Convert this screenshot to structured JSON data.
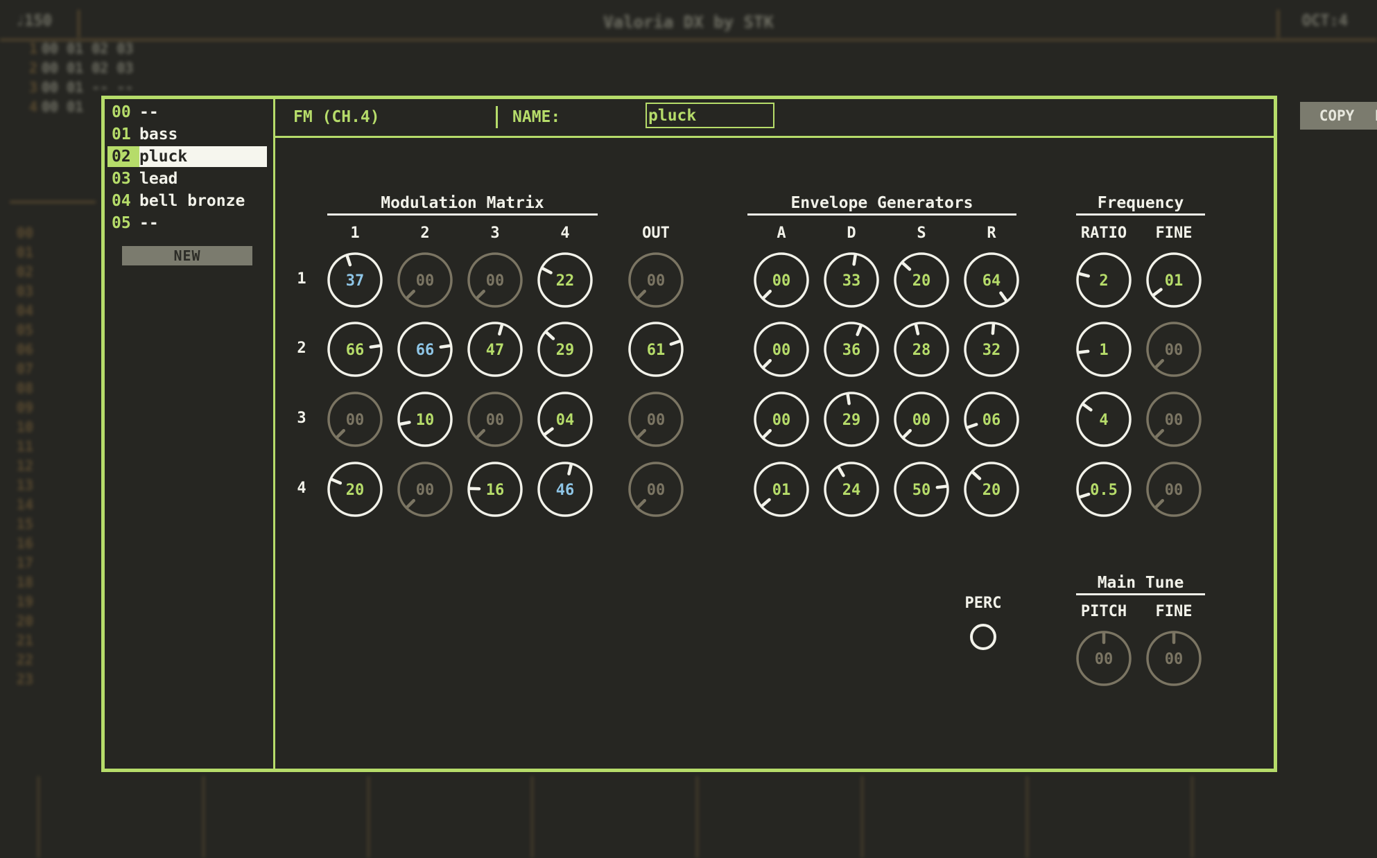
{
  "background": {
    "bpm": "♩150",
    "title": "Valoria DX by STK",
    "octave": "OCT:4",
    "rows": [
      {
        "num": "1",
        "cells": "00 01 02 03"
      },
      {
        "num": "2",
        "cells": "00 01 02 03"
      },
      {
        "num": "3",
        "cells": "00 01 -- --"
      },
      {
        "num": "4",
        "cells": "00 01"
      }
    ],
    "row_numbers_lower": [
      "00",
      "01",
      "02",
      "03",
      "04",
      "05",
      "06",
      "07",
      "08",
      "09",
      "10",
      "11",
      "12",
      "13",
      "14",
      "15",
      "16",
      "17",
      "18",
      "19",
      "20",
      "21",
      "22",
      "23"
    ]
  },
  "patch_list": {
    "items": [
      {
        "num": "00",
        "name": "--"
      },
      {
        "num": "01",
        "name": "bass"
      },
      {
        "num": "02",
        "name": "pluck"
      },
      {
        "num": "03",
        "name": "lead"
      },
      {
        "num": "04",
        "name": "bell bronze"
      },
      {
        "num": "05",
        "name": "--"
      }
    ],
    "selected_index": 2,
    "new_label": "NEW"
  },
  "header": {
    "channel": "FM (CH.4)",
    "name_label": "NAME:",
    "name_value": "pluck",
    "copy_label": "COPY",
    "delete_label": "DELETE"
  },
  "modulation_matrix": {
    "title": "Modulation Matrix",
    "columns": [
      "1",
      "2",
      "3",
      "4"
    ],
    "out_label": "OUT",
    "rows": [
      "1",
      "2",
      "3",
      "4"
    ],
    "values": [
      [
        "37",
        "00",
        "00",
        "22"
      ],
      [
        "66",
        "66",
        "47",
        "29"
      ],
      [
        "00",
        "10",
        "00",
        "04"
      ],
      [
        "20",
        "00",
        "16",
        "46"
      ]
    ],
    "out_values": [
      "00",
      "61",
      "00",
      "00"
    ],
    "feedback_cells": [
      [
        0,
        0
      ],
      [
        1,
        1
      ],
      [
        3,
        3
      ]
    ]
  },
  "envelope": {
    "title": "Envelope Generators",
    "columns": [
      "A",
      "D",
      "S",
      "R"
    ],
    "values": [
      [
        "00",
        "33",
        "20",
        "64"
      ],
      [
        "00",
        "36",
        "28",
        "32"
      ],
      [
        "00",
        "29",
        "00",
        "06"
      ],
      [
        "01",
        "24",
        "50",
        "20"
      ]
    ]
  },
  "frequency": {
    "title": "Frequency",
    "columns": [
      "RATIO",
      "FINE"
    ],
    "ratio_values": [
      "2",
      "1",
      "4",
      "0.5"
    ],
    "ratio_levels": [
      0.22,
      0.14,
      0.3,
      0.1
    ],
    "fine_values": [
      "01",
      "00",
      "00",
      "00"
    ]
  },
  "perc": {
    "label": "PERC"
  },
  "main_tune": {
    "title": "Main Tune",
    "columns": [
      "PITCH",
      "FINE"
    ],
    "values": [
      "00",
      "00"
    ]
  },
  "colors": {
    "accent": "#b6dc6a",
    "active_ring": "#f2f2ea",
    "inactive_ring": "#7b7563",
    "feedback_text": "#8ec5e6",
    "inactive_text": "#7b7563",
    "background": "#262622"
  }
}
